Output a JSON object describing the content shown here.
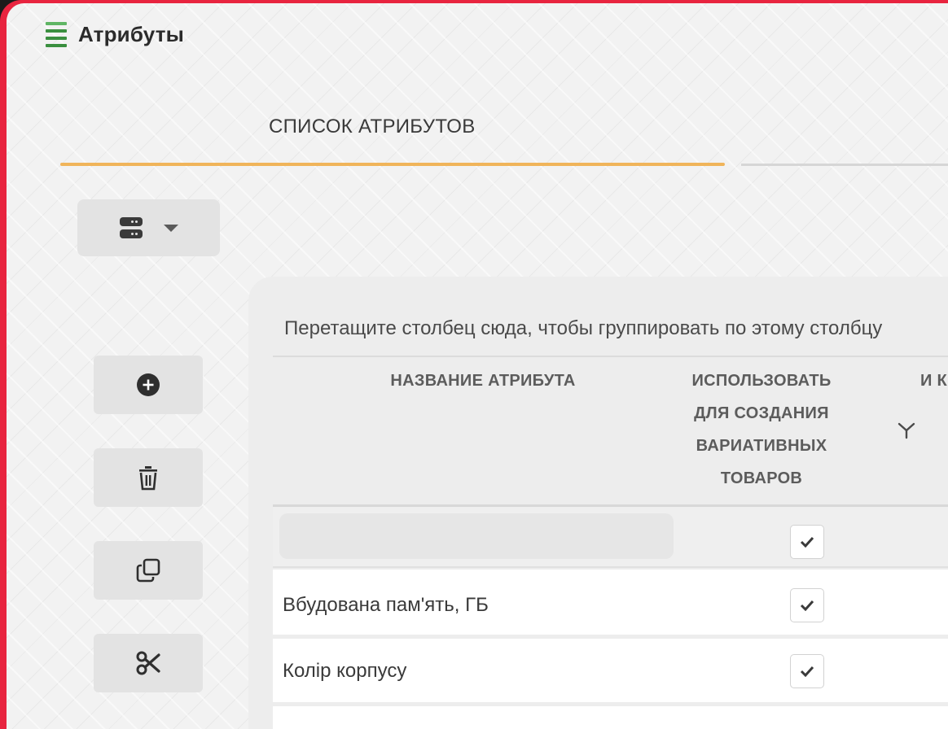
{
  "header": {
    "title": "Атрибуты",
    "menu_icon": "hamburger-icon"
  },
  "tabs": [
    {
      "label": "СПИСОК АТРИБУТОВ",
      "active": true
    }
  ],
  "toolbar": {
    "view_icon": "database-icon",
    "view_caret_icon": "caret-down-icon",
    "side_buttons": [
      {
        "icon": "plus-circle-icon"
      },
      {
        "icon": "trash-icon"
      },
      {
        "icon": "copy-icon"
      },
      {
        "icon": "scissors-icon"
      }
    ]
  },
  "grid": {
    "group_hint": "Перетащите столбец сюда, чтобы группировать по этому столбцу",
    "columns": [
      {
        "label": "НАЗВАНИЕ АТРИБУТА"
      },
      {
        "label": "ИСПОЛЬЗОВАТЬ ДЛЯ СОЗДАНИЯ ВАРИАТИВНЫХ ТОВАРОВ"
      },
      {
        "label": "И К"
      }
    ],
    "filter": {
      "name_value": "",
      "variative_checked": true
    },
    "rows": [
      {
        "name": "Вбудована пам'ять, ГБ",
        "variative": true
      },
      {
        "name": "Колір корпусу",
        "variative": true
      }
    ]
  },
  "colors": {
    "accent_tab": "#f0b45a",
    "frame": "#e8243f",
    "menu_icon": "#3a8f3f"
  }
}
